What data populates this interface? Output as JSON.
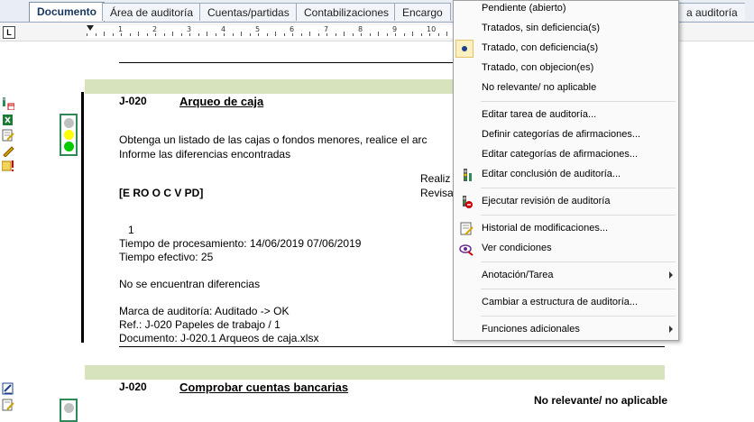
{
  "tabs": [
    "Documento",
    "Área de auditoría",
    "Cuentas/partidas",
    "Contabilizaciones",
    "Encargo",
    "a auditoría"
  ],
  "ruler": {
    "tab_selector": "L",
    "numbers": [
      "1",
      "2",
      "3",
      "4",
      "5",
      "6",
      "7",
      "8",
      "9",
      "10"
    ]
  },
  "section1": {
    "code": "J-020",
    "title": "Arqueo de caja",
    "instructions": [
      "Obtenga un listado de las cajas o fondos menores, realice el arc",
      "Informe las diferencias encontradas"
    ],
    "realizado": "Realiz",
    "revisado": "Revisa",
    "assertions": "[E RO O C V PD]",
    "number": "1",
    "processing_time": "Tiempo de procesamiento: 14/06/2019  07/06/2019",
    "effective_time": "Tiempo efectivo: 25",
    "conclusion": "No se encuentran diferencias",
    "audit_mark": "Marca de auditoría: Auditado -> OK",
    "reference": "Ref.: J-020  Papeles de trabajo / 1",
    "document": "Documento: J-020.1 Arqueos de caja.xlsx"
  },
  "section2": {
    "code": "J-020",
    "title": "Comprobar cuentas bancarias",
    "status": "No relevante/ no aplicable"
  },
  "colors": {
    "band": "#d6e3bc",
    "traffic_red_off": "#c0c0c0",
    "traffic_yellow": "#ffff00",
    "traffic_green": "#00cc00"
  },
  "menu": {
    "status_items": [
      {
        "label": "Pendiente (abierto)",
        "selected": false
      },
      {
        "label": "Tratados, sin deficiencia(s)",
        "selected": false
      },
      {
        "label": "Tratado, con deficiencia(s)",
        "selected": true
      },
      {
        "label": "Tratado, con objecion(es)",
        "selected": false
      },
      {
        "label": "No relevante/ no aplicable",
        "selected": false
      }
    ],
    "edit_task": "Editar tarea de auditoría...",
    "define_categories": "Definir categorías de afirmaciones...",
    "edit_categories": "Editar categorías de afirmaciones...",
    "edit_conclusion": "Editar conclusión de auditoría...",
    "run_review": "Ejecutar revisión de auditoría",
    "history": "Historial de modificaciones...",
    "conditions": "Ver condiciones",
    "annotation": "Anotación/Tarea",
    "change_structure": "Cambiar a estructura de auditoría...",
    "additional_functions": "Funciones adicionales"
  }
}
